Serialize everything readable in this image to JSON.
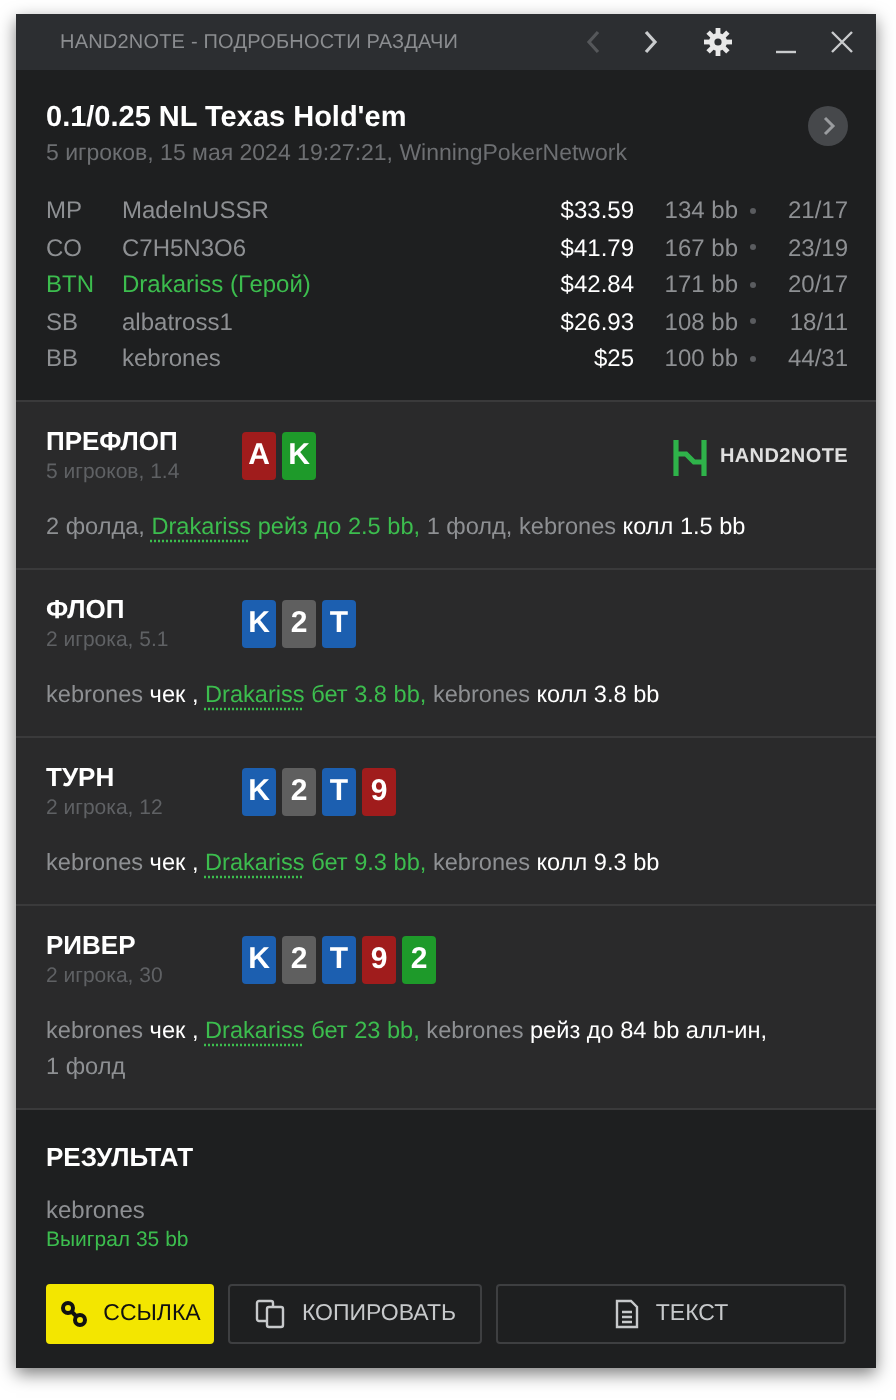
{
  "window": {
    "title": "HAND2NOTE - ПОДРОБНОСТИ РАЗДАЧИ",
    "controls": [
      {
        "kind": "prev",
        "disabled": true
      },
      {
        "kind": "next"
      },
      {
        "kind": "settings"
      },
      {
        "kind": "minimize"
      },
      {
        "kind": "close"
      }
    ]
  },
  "hand": {
    "title": "0.1/0.25 NL Texas Hold'em",
    "subtitle": "5 игроков, 15 мая 2024 19:27:21, WinningPokerNetwork"
  },
  "players": [
    {
      "position": "MP",
      "name": "MadeInUSSR",
      "hero": false,
      "stack": "$33.59",
      "bb": "134 bb",
      "stats": "21/17"
    },
    {
      "position": "CO",
      "name": "C7H5N3O6",
      "hero": false,
      "stack": "$41.79",
      "bb": "167 bb",
      "stats": "23/19"
    },
    {
      "position": "BTN",
      "name": "Drakariss (Герой)",
      "hero": true,
      "stack": "$42.84",
      "bb": "171 bb",
      "stats": "20/17"
    },
    {
      "position": "SB",
      "name": "albatross1",
      "hero": false,
      "stack": "$26.93",
      "bb": "108 bb",
      "stats": "18/11"
    },
    {
      "position": "BB",
      "name": "kebrones",
      "hero": false,
      "stack": "$25",
      "bb": "100 bb",
      "stats": "44/31"
    }
  ],
  "logo": "HAND2NOTE",
  "streets": [
    {
      "name": "ПРЕФЛОП",
      "info": "5 игроков, 1.4",
      "logo": true,
      "cards": [
        {
          "rank": "A",
          "color": "#a01c1c"
        },
        {
          "rank": "K",
          "color": "#1e9a2a"
        }
      ],
      "actions": [
        {
          "kind": "plain",
          "text": "2 фолда, "
        },
        {
          "kind": "hero",
          "text": "Drakariss"
        },
        {
          "kind": "hero_action",
          "text": " рейз до 2.5 bb,"
        },
        {
          "kind": "plain",
          "text": " 1 фолд, kebrones"
        },
        {
          "kind": "action",
          "text": " колл 1.5 bb"
        }
      ]
    },
    {
      "name": "ФЛОП",
      "info": "2 игрока, 5.1",
      "logo": false,
      "cards": [
        {
          "rank": "K",
          "color": "#1c5fb0"
        },
        {
          "rank": "2",
          "color": "#5f5f5f"
        },
        {
          "rank": "T",
          "color": "#1c5fb0"
        }
      ],
      "actions": [
        {
          "kind": "plain",
          "text": "kebrones"
        },
        {
          "kind": "action",
          "text": " чек , "
        },
        {
          "kind": "hero",
          "text": "Drakariss"
        },
        {
          "kind": "hero_action",
          "text": " бет 3.8 bb,"
        },
        {
          "kind": "plain",
          "text": " kebrones"
        },
        {
          "kind": "action",
          "text": " колл 3.8 bb"
        }
      ]
    },
    {
      "name": "ТУРН",
      "info": "2 игрока, 12",
      "logo": false,
      "cards": [
        {
          "rank": "K",
          "color": "#1c5fb0"
        },
        {
          "rank": "2",
          "color": "#5f5f5f"
        },
        {
          "rank": "T",
          "color": "#1c5fb0"
        },
        {
          "rank": "9",
          "color": "#a01c1c"
        }
      ],
      "actions": [
        {
          "kind": "plain",
          "text": "kebrones"
        },
        {
          "kind": "action",
          "text": " чек , "
        },
        {
          "kind": "hero",
          "text": "Drakariss"
        },
        {
          "kind": "hero_action",
          "text": " бет 9.3 bb,"
        },
        {
          "kind": "plain",
          "text": " kebrones"
        },
        {
          "kind": "action",
          "text": " колл 9.3 bb"
        }
      ]
    },
    {
      "name": "РИВЕР",
      "info": "2 игрока, 30",
      "logo": false,
      "cards": [
        {
          "rank": "K",
          "color": "#1c5fb0"
        },
        {
          "rank": "2",
          "color": "#5f5f5f"
        },
        {
          "rank": "T",
          "color": "#1c5fb0"
        },
        {
          "rank": "9",
          "color": "#a01c1c"
        },
        {
          "rank": "2",
          "color": "#1e9a2a"
        }
      ],
      "actions": [
        {
          "kind": "plain",
          "text": "kebrones"
        },
        {
          "kind": "action",
          "text": " чек , "
        },
        {
          "kind": "hero",
          "text": "Drakariss"
        },
        {
          "kind": "hero_action",
          "text": " бет 23 bb,"
        },
        {
          "kind": "plain",
          "text": " kebrones"
        },
        {
          "kind": "action",
          "text": " рейз до 84 bb алл-ин, "
        },
        {
          "kind": "plain",
          "text": "1 фолд"
        }
      ]
    }
  ],
  "result": {
    "title": "РЕЗУЛЬТАТ",
    "winner": "kebrones",
    "won": "Выиграл 35 bb"
  },
  "buttons": [
    {
      "kind": "link",
      "label": "ССЫЛКА",
      "primary": true
    },
    {
      "kind": "copy",
      "label": "КОПИРОВАТЬ",
      "primary": false
    },
    {
      "kind": "text",
      "label": "ТЕКСТ",
      "primary": false
    }
  ]
}
